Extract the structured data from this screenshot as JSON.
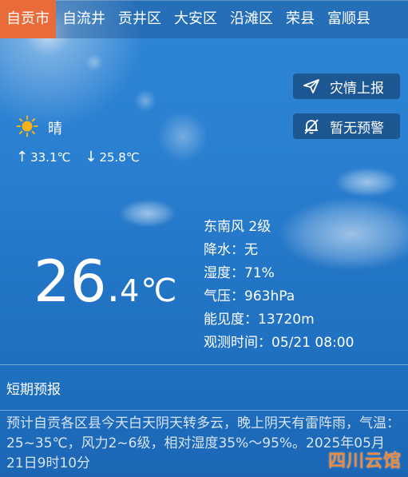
{
  "tabs": [
    {
      "label": "自贡市",
      "active": true
    },
    {
      "label": "自流井",
      "active": false
    },
    {
      "label": "贡井区",
      "active": false
    },
    {
      "label": "大安区",
      "active": false
    },
    {
      "label": "沿滩区",
      "active": false
    },
    {
      "label": "荣县",
      "active": false
    },
    {
      "label": "富顺县",
      "active": false
    }
  ],
  "actions": {
    "report_label": "灾情上报",
    "warning_label": "暂无预警"
  },
  "weather": {
    "icon": "sun-icon",
    "condition": "晴",
    "high": "33.1℃",
    "low": "25.8℃",
    "high_arrow": "↑",
    "low_arrow": "↓"
  },
  "current": {
    "temp_int": "26",
    "temp_dot": ".",
    "temp_dec": "4",
    "temp_unit": "℃"
  },
  "details": {
    "wind": "东南风 2级",
    "precip": "降水：无",
    "humidity": "湿度：71%",
    "pressure": "气压：963hPa",
    "visibility": "能见度：13720m",
    "observed": "观测时间：05/21 08:00"
  },
  "forecast": {
    "title": "短期预报",
    "text": "预计自贡各区县今天白天阴天转多云，晚上阴天有雷阵雨，气温：25~35℃，风力2~6级，相对湿度35%～95%。2025年05月21日9时10分"
  },
  "watermark": "四川云馆",
  "colors": {
    "active_tab": "#e96b3a",
    "sky": "#1f72c4",
    "button_bg": "#12345f",
    "sun": "#f3b316"
  }
}
